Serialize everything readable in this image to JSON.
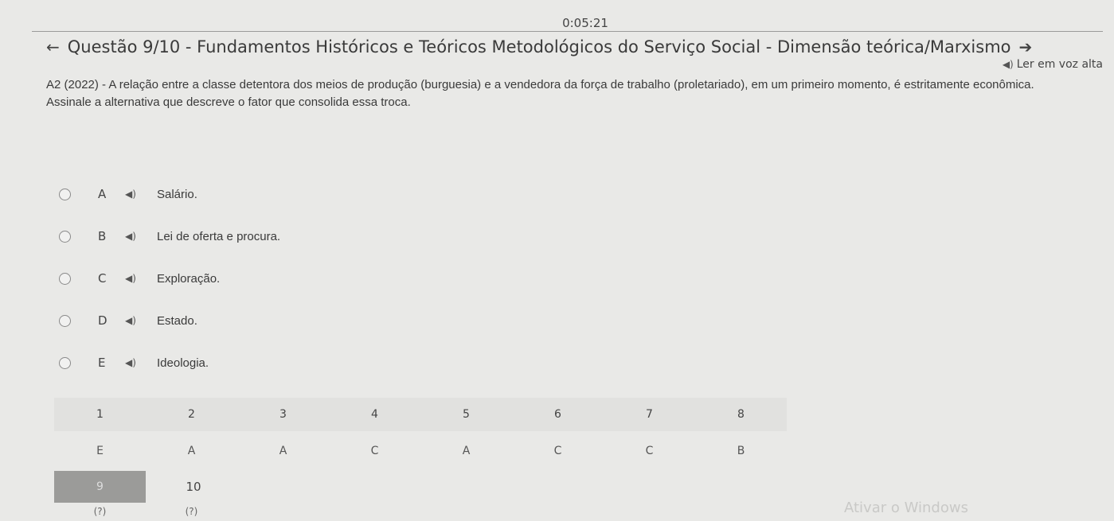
{
  "timer": "0:05:21",
  "header": {
    "title": "Questão 9/10 - Fundamentos Históricos e Teóricos Metodológicos do Serviço Social - Dimensão teórica/Marxismo",
    "prev_icon": "←",
    "next_icon": "➔"
  },
  "tts": {
    "speaker_icon": "◀)",
    "label": "Ler em voz alta"
  },
  "question": {
    "text": "A2 (2022) - A relação entre a classe detentora dos meios de produção (burguesia) e a vendedora da força de trabalho (proletariado), em um primeiro momento, é estritamente econômica. Assinale a alternativa que descreve o fator que consolida essa troca."
  },
  "options": [
    {
      "letter": "A",
      "speaker_icon": "◀)",
      "text": "Salário."
    },
    {
      "letter": "B",
      "speaker_icon": "◀)",
      "text": "Lei de oferta e procura."
    },
    {
      "letter": "C",
      "speaker_icon": "◀)",
      "text": "Exploração."
    },
    {
      "letter": "D",
      "speaker_icon": "◀)",
      "text": "Estado."
    },
    {
      "letter": "E",
      "speaker_icon": "◀)",
      "text": "Ideologia."
    }
  ],
  "answer_grid": {
    "numbers": [
      "1",
      "2",
      "3",
      "4",
      "5",
      "6",
      "7",
      "8"
    ],
    "answers": [
      "E",
      "A",
      "A",
      "C",
      "A",
      "C",
      "C",
      "B"
    ],
    "numbers2": [
      "9",
      "10"
    ],
    "answers2": [
      "(?)",
      "(?)"
    ]
  },
  "watermark": "Ativar o Windows"
}
